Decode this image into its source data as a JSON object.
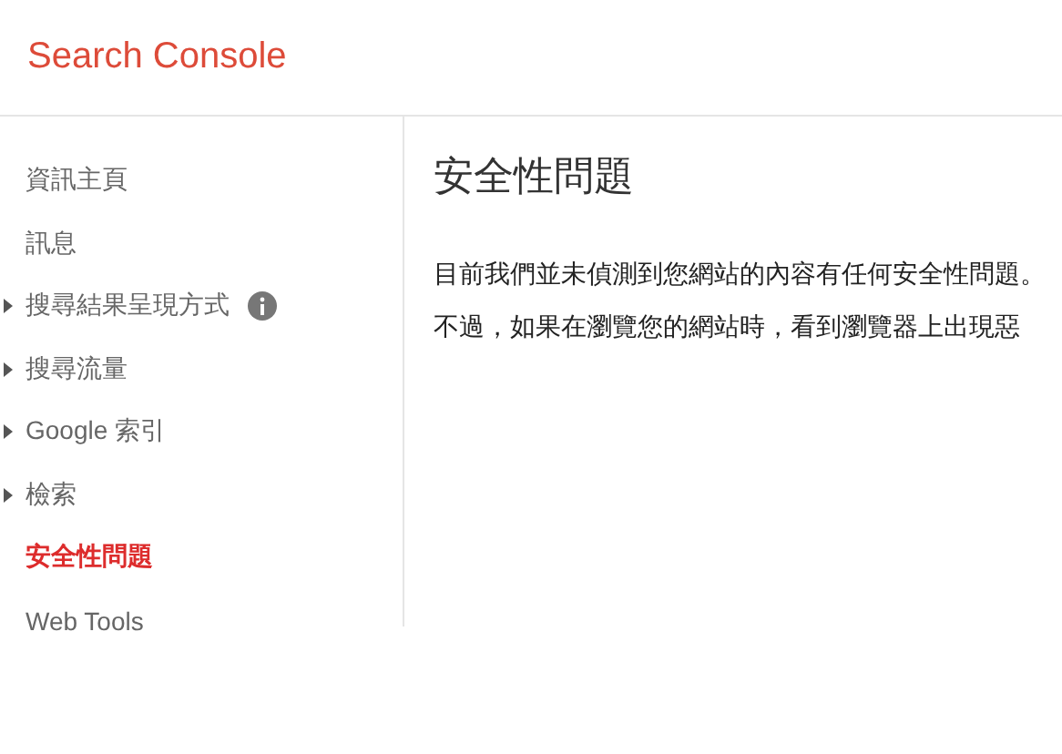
{
  "header": {
    "title": "Search Console"
  },
  "sidebar": {
    "items": [
      {
        "label": "資訊主頁",
        "expandable": false,
        "selected": false,
        "info": false
      },
      {
        "label": "訊息",
        "expandable": false,
        "selected": false,
        "info": false
      },
      {
        "label": "搜尋結果呈現方式",
        "expandable": true,
        "selected": false,
        "info": true
      },
      {
        "label": "搜尋流量",
        "expandable": true,
        "selected": false,
        "info": false
      },
      {
        "label": "Google 索引",
        "expandable": true,
        "selected": false,
        "info": false
      },
      {
        "label": "檢索",
        "expandable": true,
        "selected": false,
        "info": false
      },
      {
        "label": "安全性問題",
        "expandable": false,
        "selected": true,
        "info": false
      },
      {
        "label": "Web Tools",
        "expandable": false,
        "selected": false,
        "info": false
      }
    ]
  },
  "content": {
    "title": "安全性問題",
    "paragraphs": [
      "目前我們並未偵測到您網站的內容有任何安全性問題。",
      "不過，如果在瀏覽您的網站時，看到瀏覽器上出現惡"
    ]
  }
}
